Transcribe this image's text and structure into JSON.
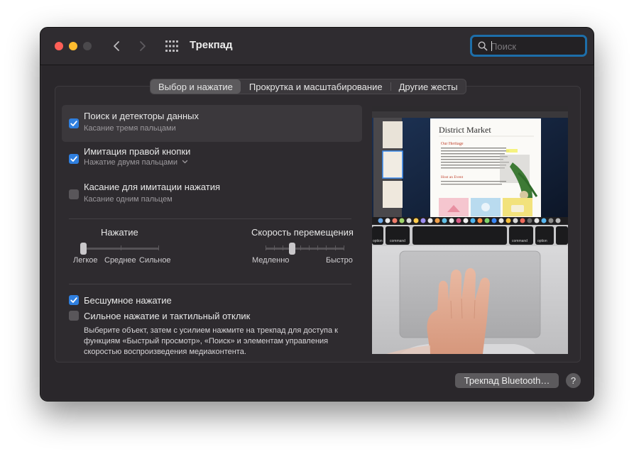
{
  "window": {
    "title": "Трекпад"
  },
  "search": {
    "placeholder": "Поиск"
  },
  "tabs": [
    {
      "label": "Выбор и нажатие",
      "active": true
    },
    {
      "label": "Прокрутка и масштабирование",
      "active": false
    },
    {
      "label": "Другие жесты",
      "active": false
    }
  ],
  "options": [
    {
      "title": "Поиск и детекторы данных",
      "subtitle": "Касание тремя пальцами",
      "checked": true
    },
    {
      "title": "Имитация правой кнопки",
      "subtitle": "Нажатие двумя пальцами",
      "checked": true
    },
    {
      "title": "Касание для имитации нажатия",
      "subtitle": "Касание одним пальцем",
      "checked": false
    }
  ],
  "click_slider": {
    "title": "Нажатие",
    "labels": [
      "Легкое",
      "Среднее",
      "Сильное"
    ],
    "value_index": 0,
    "steps": 3
  },
  "speed_slider": {
    "title": "Скорость перемещения",
    "min_label": "Медленно",
    "max_label": "Быстро",
    "value_index": 3,
    "steps": 10
  },
  "silent_click": {
    "label": "Бесшумное нажатие",
    "checked": true
  },
  "force_click": {
    "label": "Сильное нажатие и тактильный отклик",
    "checked": false,
    "description": "Выберите объект, затем с усилием нажмите на трекпад для доступа к функциям «Быстрый просмотр», «Поиск» и элементам управления скоростью воспроизведения медиаконтента."
  },
  "preview": {
    "doc_title": "District Market",
    "heading1": "Our Heritage",
    "heading2": "Host an Event",
    "keys": {
      "option": "option",
      "command": "command"
    }
  },
  "footer": {
    "bluetooth_button": "Трекпад Bluetooth…",
    "help_button": "?"
  },
  "colors": {
    "accent": "#2f7fdf",
    "search_focus": "#1d6ea9",
    "close": "#fe5f57",
    "minimize": "#febc2e"
  }
}
